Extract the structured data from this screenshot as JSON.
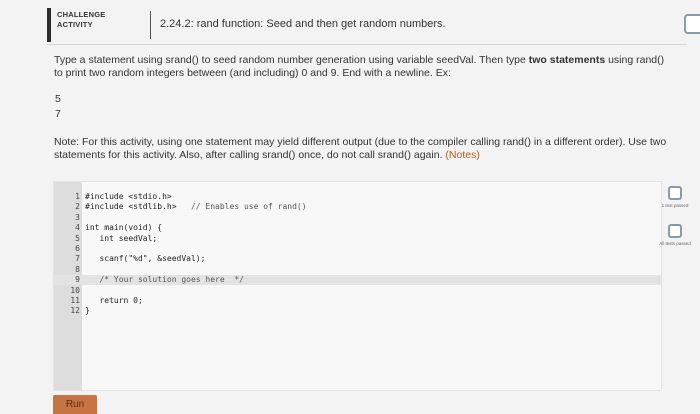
{
  "header": {
    "tag_line1": "CHALLENGE",
    "tag_line2": "ACTIVITY",
    "title": "2.24.2: rand function: Seed and then get random numbers."
  },
  "instructions": {
    "text_part1": "Type a statement using srand() to seed random number generation using variable seedVal. Then type ",
    "text_bold": "two statements",
    "text_part2": " using rand() to print two random integers between (and including) 0 and 9. End with a newline. Ex:",
    "example_line1": "5",
    "example_line2": "7",
    "note": "Note: For this activity, using one statement may yield different output (due to the compiler calling rand() in a different order). Use two statements for this activity. Also, after calling srand() once, do not call srand() again.",
    "notes_link": "(Notes)"
  },
  "code_lines": [
    {
      "n": "1",
      "code": "#include <stdio.h>",
      "comment": ""
    },
    {
      "n": "2",
      "code": "#include <stdlib.h>",
      "comment": "   // Enables use of rand()"
    },
    {
      "n": "3",
      "code": "",
      "comment": ""
    },
    {
      "n": "4",
      "code": "int main(void) {",
      "comment": ""
    },
    {
      "n": "5",
      "code": "   int seedVal;",
      "comment": ""
    },
    {
      "n": "6",
      "code": "",
      "comment": ""
    },
    {
      "n": "7",
      "code": "   scanf(\"%d\", &seedVal);",
      "comment": ""
    },
    {
      "n": "8",
      "code": "",
      "comment": ""
    },
    {
      "n": "9",
      "code": "   ",
      "comment": "/* Your solution goes here  */"
    },
    {
      "n": "10",
      "code": "",
      "comment": ""
    },
    {
      "n": "11",
      "code": "   return 0;",
      "comment": ""
    },
    {
      "n": "12",
      "code": "}",
      "comment": ""
    }
  ],
  "active_line": 9,
  "side": {
    "test1_label": "1 test passed",
    "test2_label": "All tests passed"
  },
  "run_button": "Run"
}
